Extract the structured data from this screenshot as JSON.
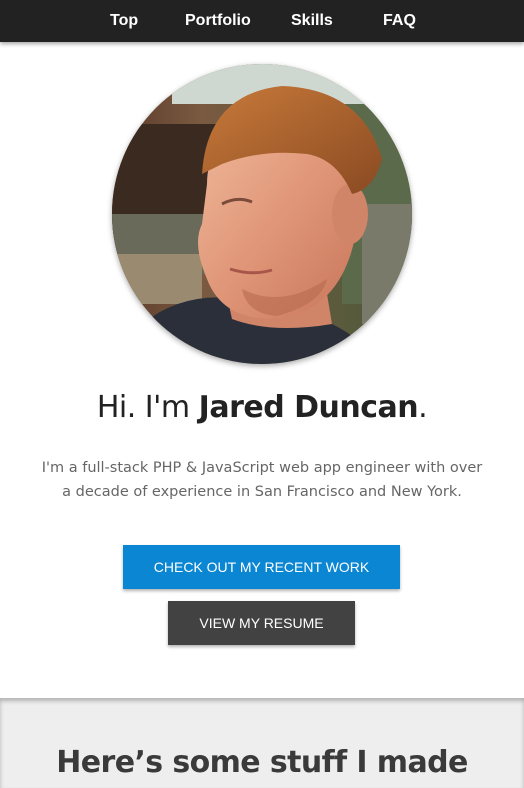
{
  "nav": {
    "items": [
      {
        "label": "Top"
      },
      {
        "label": "Portfolio"
      },
      {
        "label": "Skills"
      },
      {
        "label": "FAQ"
      }
    ]
  },
  "hero": {
    "greeting": "Hi. I'm ",
    "name": "Jared Duncan",
    "period": ".",
    "intro": "I'm a full-stack PHP & JavaScript web app engineer with over a decade of experience in San Francisco and New York.",
    "buttons": {
      "work": "CHECK OUT MY RECENT WORK",
      "resume": "VIEW MY RESUME"
    },
    "avatar_icon": "profile-photo"
  },
  "section2": {
    "title": "Here’s some stuff I made"
  },
  "colors": {
    "navbar": "#222222",
    "primary_button": "#0a86d3",
    "secondary_button": "#424242",
    "section_bg": "#eeeeee"
  }
}
